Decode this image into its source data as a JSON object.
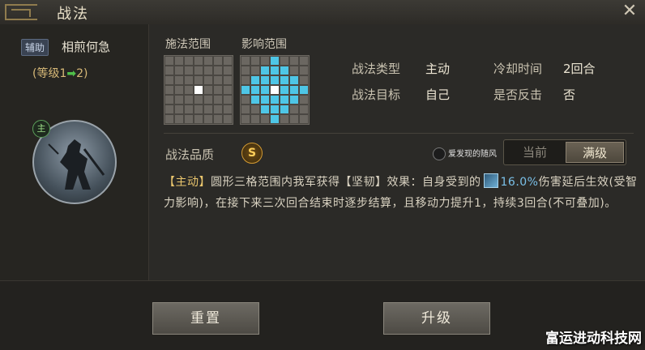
{
  "window": {
    "title": "战法",
    "close_icon": "close-icon"
  },
  "left": {
    "tag": "辅助",
    "skill_name": "相煎何急",
    "level_prefix": "(等级1",
    "level_arrow": "➡",
    "level_suffix": "2)",
    "main_badge": "主"
  },
  "grids": {
    "cast_label": "施法范围",
    "effect_label": "影响范围",
    "cast_cells": [
      [
        3,
        3
      ]
    ],
    "effect_cells": [
      [
        3,
        0
      ],
      [
        2,
        1
      ],
      [
        3,
        1
      ],
      [
        4,
        1
      ],
      [
        1,
        2
      ],
      [
        2,
        2
      ],
      [
        3,
        2
      ],
      [
        4,
        2
      ],
      [
        5,
        2
      ],
      [
        0,
        3
      ],
      [
        1,
        3
      ],
      [
        2,
        3
      ],
      [
        4,
        3
      ],
      [
        5,
        3
      ],
      [
        6,
        3
      ],
      [
        1,
        4
      ],
      [
        2,
        4
      ],
      [
        3,
        4
      ],
      [
        4,
        4
      ],
      [
        5,
        4
      ],
      [
        2,
        5
      ],
      [
        3,
        5
      ],
      [
        4,
        5
      ],
      [
        3,
        6
      ]
    ],
    "effect_center": [
      3,
      3
    ],
    "colors": {
      "cell": "#6b6761",
      "line": "#4a4742",
      "cast": "#ffffff",
      "effect": "#4ec6e6",
      "center": "#ffffff"
    }
  },
  "info": {
    "type_label": "战法类型",
    "type_value": "主动",
    "cooldown_label": "冷却时间",
    "cooldown_value": "2回合",
    "target_label": "战法目标",
    "target_value": "自己",
    "counter_label": "是否反击",
    "counter_value": "否"
  },
  "quality": {
    "label": "战法品质",
    "grade": "S"
  },
  "watermark": {
    "text": "爱发现的随风"
  },
  "toggle": {
    "current": "当前",
    "max": "满级"
  },
  "description": {
    "tag": "【主动】",
    "part1": "圆形三格范围内我军获得【坚韧】效果：自身受到的",
    "percent": "16.0%",
    "part2": "伤害延后生效(受智力影响)，在接下来三次回合结束时逐步结算，且移动力提升1，持续3回合(不可叠加)。"
  },
  "buttons": {
    "reset": "重置",
    "upgrade": "升级"
  },
  "site_watermark": "富运进动科技网"
}
